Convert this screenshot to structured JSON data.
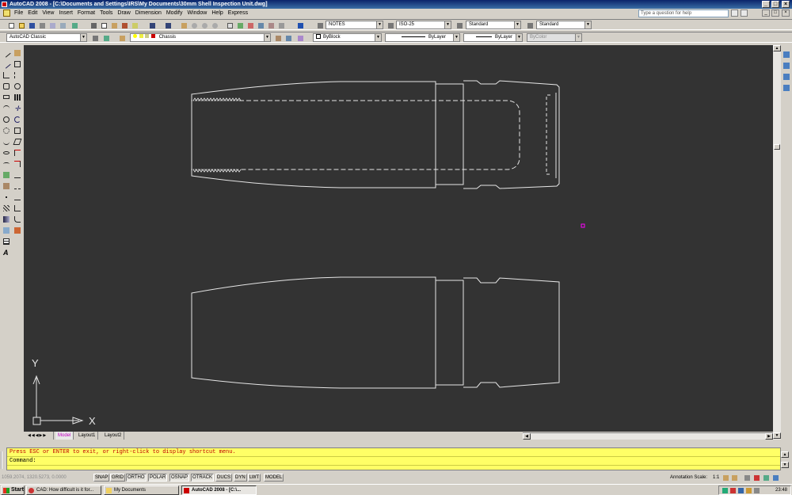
{
  "window": {
    "title": "AutoCAD 2008 - [C:\\Documents and Settings\\IRS\\My Documents\\30mm Shell Inspection Unit.dwg]",
    "help_placeholder": "Type a question for help"
  },
  "menu": [
    "File",
    "Edit",
    "View",
    "Insert",
    "Format",
    "Tools",
    "Draw",
    "Dimension",
    "Modify",
    "Window",
    "Help",
    "Express"
  ],
  "styles_toolbar": {
    "text_style": "NOTES",
    "dim_style": "ISO-25",
    "table_style": "Standard",
    "multileader_style": "Standard"
  },
  "layers_toolbar": {
    "workspace": "AutoCAD Classic",
    "layer": "Chassis"
  },
  "properties_toolbar": {
    "color": "ByBlock",
    "linetype": "ByLayer",
    "lineweight": "ByLayer",
    "plotstyle": "ByColor"
  },
  "ucs": {
    "x_label": "X",
    "y_label": "Y"
  },
  "layout_tabs": [
    "Model",
    "Layout1",
    "Layout2"
  ],
  "command": {
    "history": "Press ESC or ENTER to exit, or right-click to display shortcut menu.",
    "prompt": "Command:"
  },
  "status": {
    "coords": "1059.2074, 1320.5273, 0.0000",
    "toggles": [
      "SNAP",
      "GRID",
      "ORTHO",
      "POLAR",
      "OSNAP",
      "OTRACK",
      "DUCS",
      "DYN",
      "LWT",
      "MODEL"
    ],
    "annotation_scale_label": "Annotation Scale:",
    "annotation_scale_value": "1:1"
  },
  "taskbar": {
    "start": "Start",
    "tasks": [
      "CAD: How difficult is it for...",
      "My Documents",
      "AutoCAD 2008 - [C:\\..."
    ],
    "clock": "23:48"
  },
  "colors": {
    "canvas": "#333333",
    "drawing_lines": "#e6e6e6",
    "command_bg": "#ffff66",
    "command_text": "#c00000"
  }
}
